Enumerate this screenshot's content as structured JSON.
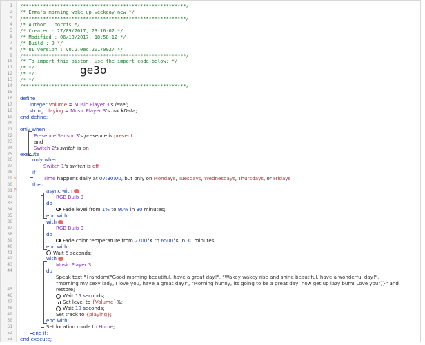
{
  "lines": [
    "/*********************************************************/",
    "/* Emma's morning wake up weekday new                    */",
    "/*********************************************************/",
    "/* Author      : borris                                  */",
    "/* Created     : 27/09/2017, 23:16:02                    */",
    "/* Modified    : 06/10/2017, 18:58:12                    */",
    "/* Build       : 9                                       */",
    "/* UI version  : v0.2.0ec.20170927                       */",
    "/*********************************************************/",
    "/* To import this piston, use the import code below:     */",
    "/*                                                       */",
    "/*                                                       */",
    "/*                                                       */",
    "/*********************************************************/"
  ],
  "import_code": "ge3o",
  "line_numbers": [
    "1",
    "2",
    "3",
    "4",
    "5",
    "6",
    "7",
    "8",
    "9",
    "10",
    "11",
    "12",
    "13",
    "14",
    "15",
    "16",
    "17",
    "18",
    "19",
    "20",
    "21",
    "22",
    "23",
    "24",
    "25",
    "26",
    "27",
    "28",
    "29",
    "30",
    "31",
    "32",
    "33",
    "34",
    "35",
    "36",
    "37",
    "38",
    "39",
    "40",
    "41",
    "42",
    "43",
    "44",
    "45",
    "46",
    "47",
    "48",
    "49",
    "50",
    "51",
    "52",
    "53"
  ],
  "code": {
    "define": "define",
    "integer": "integer",
    "volume": "Volume",
    "string": "string",
    "playing": "playing",
    "music_player": "Music Player 3",
    "level": "level",
    "track_data": "trackData",
    "eq": " = ",
    "apos_s": "'s ",
    "semi": ";",
    "end_define": "end define;",
    "only_when": "only when",
    "presence_sensor": "Presence Sensor 3",
    "presence": "presence",
    "is": " is ",
    "present": "present",
    "and": "and",
    "switch2": "Switch 2",
    "switch": "switch",
    "on": "on",
    "execute": "execute",
    "switch1": "Switch 1",
    "off": "off",
    "if": "if",
    "time": "Time",
    "happens_daily_at": " happens daily at ",
    "time_val": "07:30:00",
    "but_only_on": ", but only on ",
    "mondays": "Mondays",
    "tuesdays": "Tuesdays",
    "wednesdays": "Wednesdays",
    "thursdays": "Thursdays",
    "fridays": "Fridays",
    "comma": ", ",
    "or": ", or ",
    "then": "then",
    "async_with": "async with",
    "rgb_bulb": "RGB Bulb 3",
    "do": "do",
    "fade_level_pre": "Fade level from ",
    "pct1": "1%",
    "to": " to ",
    "pct90": "90%",
    "in": " in ",
    "thirty": "30",
    "minutes": " minutes;",
    "end_with": "end with;",
    "with": "with",
    "fade_color_pre": "Fade color temperature from ",
    "k2700": "2700",
    "deg_k": "°K",
    "k6500": "6500",
    "wait": "Wait ",
    "five": "5",
    "seconds": " seconds;",
    "speak_pre": "Speak text \"",
    "speak_expr": "{random(\"Good morning beautiful, have a great day!\", \"Wakey wakey rise and shine beautiful, have a wonderful day!\", \"morning",
    "speak_line2": "my sexy lady, I love you, have a great day!\", \"Morning hunny, its going to be a great day, now get up lazy bum! Love you\")}",
    "speak_end": "\" and",
    "restore": "restore;",
    "fifteen": "15",
    "set_level": "Set level to ",
    "volume_expr": "{Volume}",
    "pct": "%;",
    "ten": "10",
    "set_track": "Set track to ",
    "playing_expr": "{playing}",
    "set_location": "Set location mode to ",
    "home": "Home",
    "end_if": "end if;",
    "end_execute": "end execute;"
  }
}
